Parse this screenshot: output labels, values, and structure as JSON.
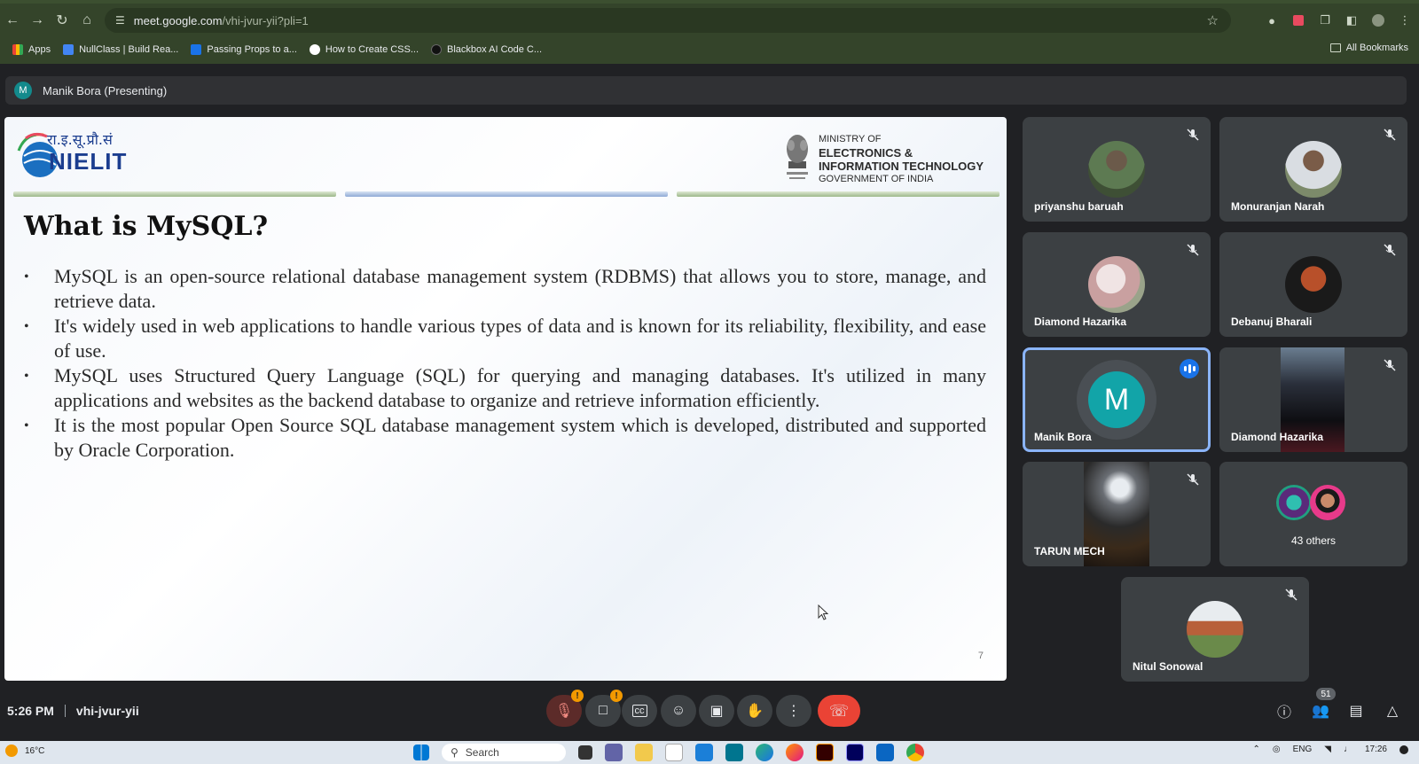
{
  "browser": {
    "url_host": "meet.google.com",
    "url_path": "/vhi-jvur-yii?pli=1",
    "bookmarks": [
      {
        "label": "Apps",
        "color": "#ea4335"
      },
      {
        "label": "NullClass | Build Rea...",
        "color": "#4285f4"
      },
      {
        "label": "Passing Props to a...",
        "color": "#1a73e8"
      },
      {
        "label": "How to Create CSS...",
        "color": "#ffffff"
      },
      {
        "label": "Blackbox AI Code C...",
        "color": "#111111"
      }
    ],
    "all_bookmarks": "All Bookmarks"
  },
  "presenter": {
    "initial": "M",
    "label": "Manik Bora (Presenting)"
  },
  "slide": {
    "logo_hindi": "रा.इ.सू.प्रौ.सं",
    "logo_name": "NIELIT",
    "ministry": [
      "MINISTRY OF",
      "ELECTRONICS &",
      "INFORMATION TECHNOLOGY",
      "GOVERNMENT OF INDIA"
    ],
    "title": "What is MySQL?",
    "bullets": [
      "MySQL is an open-source relational database management system (RDBMS) that allows you to store, manage, and retrieve data.",
      "It's widely used in web applications to handle various types of data and is known for its reliability, flexibility, and ease of use.",
      "MySQL uses Structured Query Language (SQL) for querying and managing databases. It's utilized in many applications and websites as the backend database to organize and retrieve information efficiently.",
      "It is the most popular Open Source SQL database management system which is developed, distributed and supported by Oracle Corporation."
    ],
    "page_number": "7"
  },
  "participants": [
    {
      "name": "priyanshu baruah",
      "muted": true
    },
    {
      "name": "Monuranjan Narah",
      "muted": true
    },
    {
      "name": "Diamond Hazarika",
      "muted": true
    },
    {
      "name": "Debanuj Bharali",
      "muted": true
    },
    {
      "name": "Manik Bora",
      "initial": "M",
      "speaking": true
    },
    {
      "name": "Diamond Hazarika",
      "muted": true
    },
    {
      "name": "TARUN MECH",
      "muted": true
    },
    {
      "name": "43 others"
    },
    {
      "name": "Nitul Sonowal",
      "muted": true
    }
  ],
  "meeting": {
    "time": "5:26 PM",
    "code": "vhi-jvur-yii",
    "people_count": "51",
    "mic_badge": "!",
    "cam_badge": "!"
  },
  "taskbar": {
    "temperature": "16°C",
    "search_placeholder": "Search",
    "language": "ENG",
    "clock": "17:26"
  }
}
